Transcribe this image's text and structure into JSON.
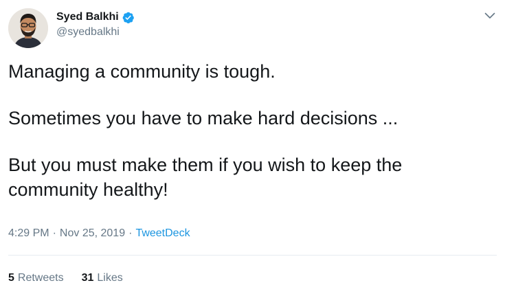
{
  "author": {
    "display_name": "Syed Balkhi",
    "handle": "@syedbalkhi",
    "verified": true,
    "avatar_icon": "profile-photo"
  },
  "tweet": {
    "lines": {
      "p1": "Managing a community is tough.",
      "p2": "Sometimes you have to make hard decisions ...",
      "p3a": "But you must make them if you wish to keep the",
      "p3b": "community healthy!"
    },
    "time": "4:29 PM",
    "date": "Nov 25, 2019",
    "separator": "·",
    "source": "TweetDeck"
  },
  "stats": {
    "retweets_count": "5",
    "retweets_label": "Retweets",
    "likes_count": "31",
    "likes_label": "Likes"
  },
  "colors": {
    "text": "#14171a",
    "muted": "#657786",
    "link": "#1b95e0",
    "verified_badge": "#1da1f2",
    "divider": "#e6ecf0"
  },
  "icons": {
    "verified": "verified-badge-icon",
    "menu": "chevron-down-icon"
  }
}
